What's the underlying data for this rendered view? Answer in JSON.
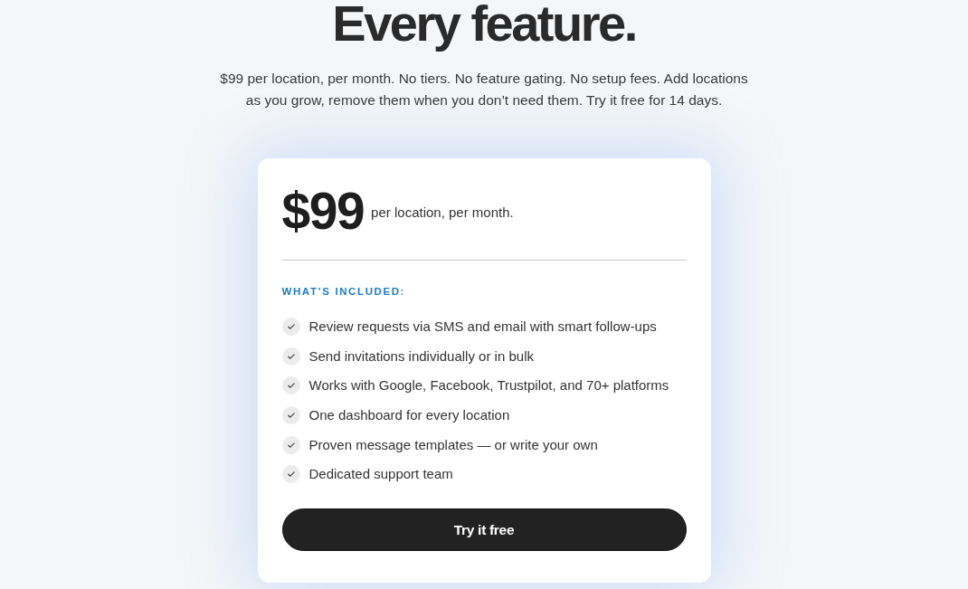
{
  "hero": {
    "title": "Every feature.",
    "subtitle": "$99 per location, per month. No tiers. No feature gating. No setup fees. Add locations as you grow, remove them when you don’t need them. Try it free for 14 days."
  },
  "pricing_card": {
    "price": "$99",
    "price_note": "per location, per month.",
    "features_heading": "WHAT’S INCLUDED:",
    "features": [
      "Review requests via SMS and email with smart follow-ups",
      "Send invitations individually or in bulk",
      "Works with Google, Facebook, Trustpilot, and 70+ platforms",
      "One dashboard for every location",
      "Proven message templates — or write your own",
      "Dedicated support team"
    ],
    "cta_button": "Try it free"
  }
}
